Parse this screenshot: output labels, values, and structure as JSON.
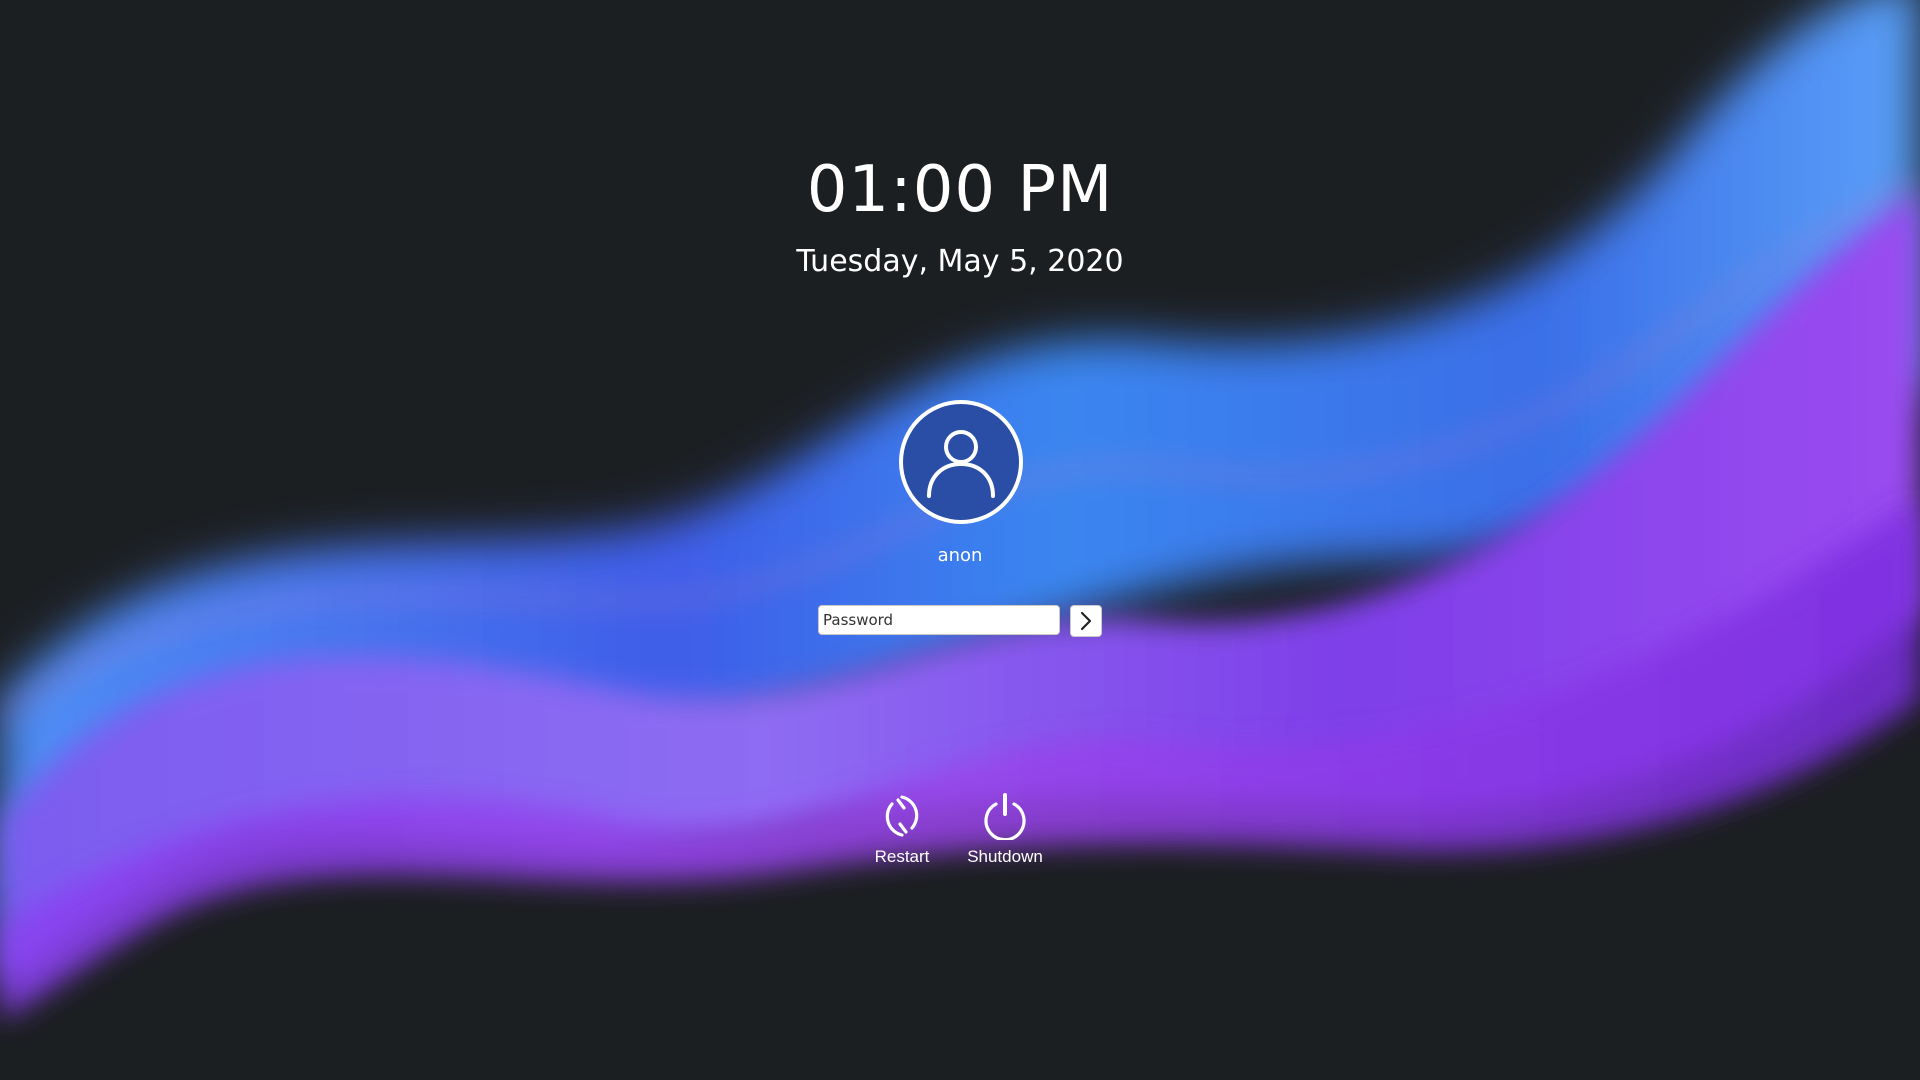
{
  "lock_screen": {
    "time": "01:00 PM",
    "date": "Tuesday, May 5, 2020"
  },
  "user": {
    "name": "anon",
    "avatar_icon": "user-icon"
  },
  "login": {
    "password_placeholder": "Password",
    "password_value": "",
    "submit_icon": "chevron-right-icon"
  },
  "power": {
    "restart_label": "Restart",
    "restart_icon": "restart-icon",
    "shutdown_label": "Shutdown",
    "shutdown_icon": "power-icon"
  },
  "colors": {
    "background": "#1c1f22",
    "wave_blue": "#3a86f0",
    "wave_violet": "#8a3ff0",
    "avatar_fill": "#2a4ea6",
    "text": "#ffffff"
  }
}
